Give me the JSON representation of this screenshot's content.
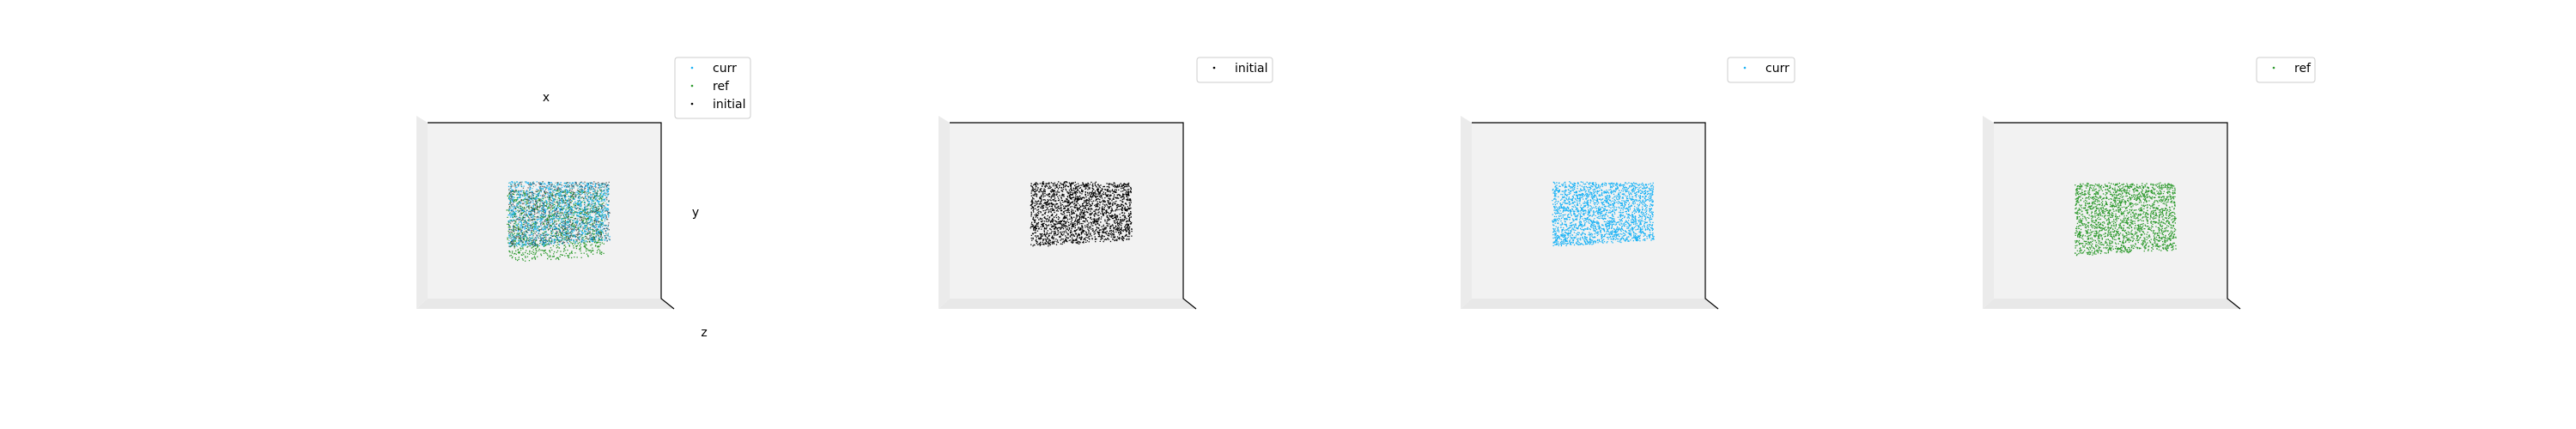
{
  "chart_data": [
    {
      "type": "scatter",
      "projection": "3d",
      "title": "",
      "xlabel": "x",
      "ylabel": "y",
      "zlabel": "z",
      "grid": false,
      "legend_position": "top-right",
      "series": [
        {
          "name": "curr",
          "color": "#1ab2f5",
          "points": 1700
        },
        {
          "name": "ref",
          "color": "#2e9a2e",
          "points": 1700
        },
        {
          "name": "initial",
          "color": "#000000",
          "points": 1700
        }
      ]
    },
    {
      "type": "scatter",
      "projection": "3d",
      "title": "",
      "grid": false,
      "legend_position": "top-right",
      "series": [
        {
          "name": "initial",
          "color": "#000000",
          "points": 2200
        }
      ]
    },
    {
      "type": "scatter",
      "projection": "3d",
      "title": "",
      "grid": false,
      "legend_position": "top-right",
      "series": [
        {
          "name": "curr",
          "color": "#1ab2f5",
          "points": 2200
        }
      ]
    },
    {
      "type": "scatter",
      "projection": "3d",
      "title": "",
      "grid": false,
      "legend_position": "top-right",
      "series": [
        {
          "name": "ref",
          "color": "#2e9a2e",
          "points": 2200
        }
      ]
    }
  ]
}
